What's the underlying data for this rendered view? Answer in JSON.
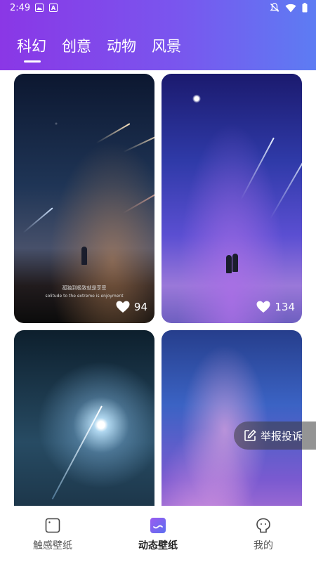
{
  "status_bar": {
    "time": "2:49",
    "left_icons": [
      "image-icon",
      "a-letter-icon"
    ],
    "right_icons": [
      "notifications-off-icon",
      "wifi-icon",
      "battery-icon"
    ],
    "letter_icon_text": "A"
  },
  "tabs": [
    {
      "label": "科幻",
      "active": true
    },
    {
      "label": "创意",
      "active": false
    },
    {
      "label": "动物",
      "active": false
    },
    {
      "label": "风景",
      "active": false
    }
  ],
  "wallpapers": [
    {
      "scene": "meteor-shower-silhouette",
      "caption_cn": "孤独到极致就是享受",
      "caption_en": "solitude to the extreme is enjoyment",
      "likes": "94"
    },
    {
      "scene": "couple-starry-sky",
      "likes": "134"
    },
    {
      "scene": "lightning-vortex"
    },
    {
      "scene": "pink-nebula-sky"
    }
  ],
  "floating": {
    "report_label": "举报投诉",
    "icon": "edit-icon"
  },
  "bottom_nav": [
    {
      "label": "触感壁纸",
      "icon": "square-icon",
      "active": false
    },
    {
      "label": "动态壁纸",
      "icon": "wallpaper-icon",
      "active": true
    },
    {
      "label": "我的",
      "icon": "profile-icon",
      "active": false
    }
  ],
  "colors": {
    "header_start": "#8a37e6",
    "header_end": "#5d7cf3",
    "active_nav_icon": "#7b45e8"
  }
}
